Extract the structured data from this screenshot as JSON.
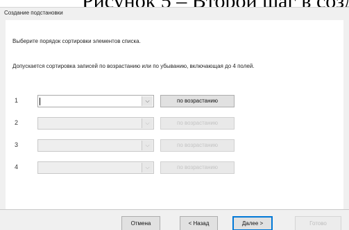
{
  "header_overlay": "Рисунок 5 – Второй шаг в созд",
  "dialog": {
    "title": "Создание подстановки",
    "instruction": "Выберите порядок сортировки элементов списка.",
    "note": "Допускается сортировка записей по возрастанию или по убыванию, включающая до 4 полей."
  },
  "sort_rows": [
    {
      "number": "1",
      "order_label": "по возрастанию",
      "enabled": true
    },
    {
      "number": "2",
      "order_label": "по возрастанию",
      "enabled": false
    },
    {
      "number": "3",
      "order_label": "по возрастанию",
      "enabled": false
    },
    {
      "number": "4",
      "order_label": "по возрастанию",
      "enabled": false
    }
  ],
  "footer": {
    "cancel": "Отмена",
    "back": "< Назад",
    "next": "Далее >",
    "finish": "Готово"
  },
  "icons": {
    "dropdown": "chevron-down-icon"
  }
}
